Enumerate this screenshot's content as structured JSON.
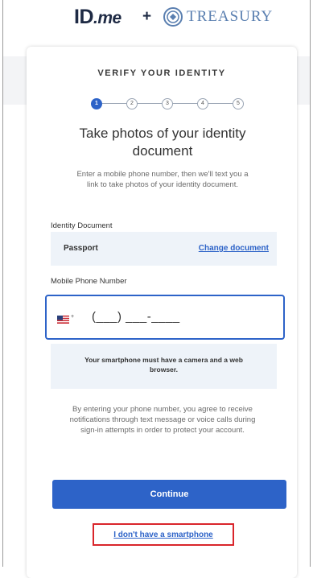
{
  "header": {
    "idme_logo": "ID.me",
    "plus": "+",
    "treasury_label": "TREASURY"
  },
  "card": {
    "title": "VERIFY YOUR IDENTITY",
    "steps": [
      "1",
      "2",
      "3",
      "4",
      "5"
    ],
    "active_step": 1,
    "heading": "Take photos of your identity document",
    "description": "Enter a mobile phone number, then we'll text you a link to take photos of your identity document.",
    "document_label": "Identity Document",
    "document_value": "Passport",
    "change_document_link": "Change document",
    "phone_label": "Mobile Phone Number",
    "phone_country_code": "+",
    "phone_placeholder": "(___) ___-____",
    "info_message": "Your smartphone must have a camera and a web browser.",
    "consent_text": "By entering your phone number, you agree to receive notifications through text message or voice calls during sign-in attempts in order to protect your account.",
    "continue_button": "Continue",
    "no_smartphone_link": "I don't have a smartphone"
  },
  "colors": {
    "primary": "#2d63c8",
    "highlight_border": "#d9252b",
    "info_bg": "#eef3f9"
  }
}
